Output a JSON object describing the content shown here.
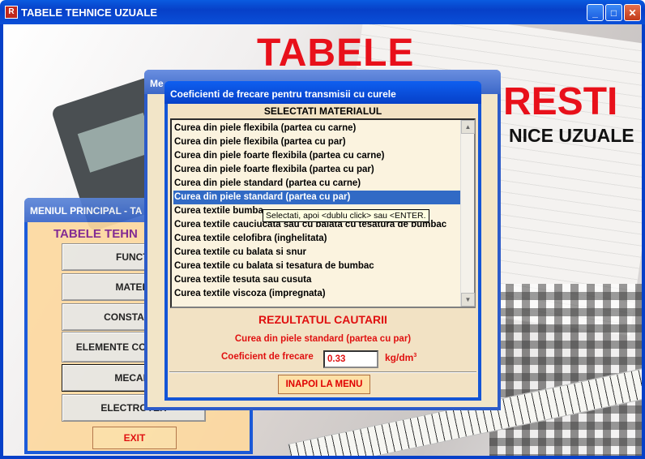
{
  "window": {
    "title": "TABELE TEHNICE UZUALE",
    "app_icon_glyph": "R"
  },
  "background": {
    "title_line1": "TABELE",
    "title_line2": "RESTI",
    "subtitle": "NICE UZUALE"
  },
  "main_menu": {
    "title": "MENIUL PRINCIPAL - TA",
    "heading": "TABELE TEHN",
    "buttons": [
      "FUNCTI",
      "MATERI",
      "CONSTANTE",
      "ELEMENTE CON METALI",
      "MECANI",
      "ELECTROTEH"
    ],
    "exit_label": "EXIT"
  },
  "middle_window": {
    "title": "Me"
  },
  "dialog": {
    "title": "Coeficienti de frecare pentru transmisii cu curele",
    "select_label": "SELECTATI MATERIALUL",
    "items": [
      "Curea din piele flexibila (partea cu carne)",
      "Curea din piele flexibila (partea cu par)",
      "Curea din piele foarte flexibila (partea cu carne)",
      "Curea din piele foarte flexibila (partea cu par)",
      "Curea din piele standard (partea cu carne)",
      "Curea din piele standard (partea cu par)",
      "Curea textile bumba",
      "Curea textile cauciucata sau cu balata cu tesatura de bumbac",
      "Curea textile celofibra (inghelitata)",
      "Curea textile cu balata si snur",
      "Curea textile cu balata si tesatura de bumbac",
      "Curea textile tesuta sau cusuta",
      "Curea textile viscoza (impregnata)"
    ],
    "selected_index": 5,
    "tooltip": "Selectati, apoi <dublu click> sau <ENTER.",
    "result_title": "REZULTATUL CAUTARII",
    "result_value": "Curea din piele standard (partea cu par)",
    "coef_label": "Coeficient de frecare",
    "coef_value": "0.33",
    "coef_unit": "kg/dm",
    "coef_unit_exp": "3",
    "back_label": "INAPOI LA MENU"
  }
}
